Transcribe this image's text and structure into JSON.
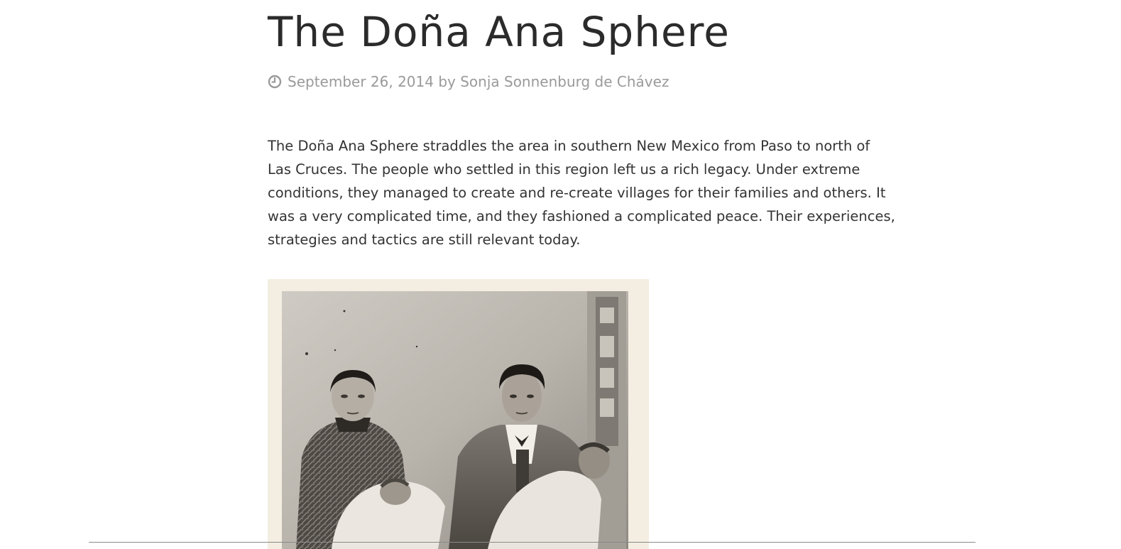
{
  "post": {
    "title": "The Doña Ana Sphere",
    "meta": {
      "icon": "clock-icon",
      "date": "September 26, 2014",
      "by": " by ",
      "author": "Sonja Sonnenburg de Chávez"
    },
    "body": "The Doña Ana Sphere straddles the area in southern New Mexico from Paso to north of\nLas Cruces. The people who settled in this region left us a rich legacy. Under extreme\nconditions, they managed to create and re-create villages for their families and others.  It\nwas a very complicated time, and they fashioned a complicated peace. Their experiences,\nstrategies and tactics are still relevant today."
  },
  "colors": {
    "title": "#2b2b2b",
    "meta": "#9a9a9a",
    "body": "#333333",
    "photo_border": "#f4eee2"
  }
}
